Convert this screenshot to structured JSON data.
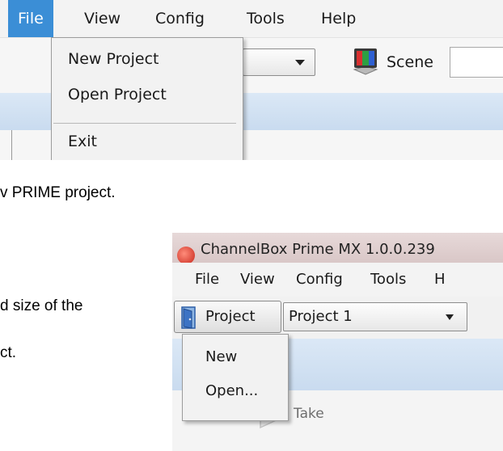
{
  "menu1": {
    "file": "File",
    "view": "View",
    "config": "Config",
    "tools": "Tools",
    "help": "Help"
  },
  "file_menu1": {
    "new_project": "New Project",
    "open_project": "Open Project",
    "exit": "Exit"
  },
  "toolbar1": {
    "scene_label": "Scene"
  },
  "doc": {
    "line1": "v PRIME project.",
    "line2": "d size of the",
    "line3": "ct."
  },
  "window2": {
    "title": "ChannelBox Prime MX 1.0.0.239",
    "menu": {
      "file": "File",
      "view": "View",
      "config": "Config",
      "tools": "Tools",
      "help_partial": "H"
    },
    "project_button": "Project",
    "project_combo_value": "Project 1",
    "project_menu": {
      "new": "New",
      "open": "Open..."
    },
    "take_label": "Take"
  },
  "colors": {
    "menu_highlight": "#3b8ed6",
    "band_blue": "#c9dbef"
  }
}
